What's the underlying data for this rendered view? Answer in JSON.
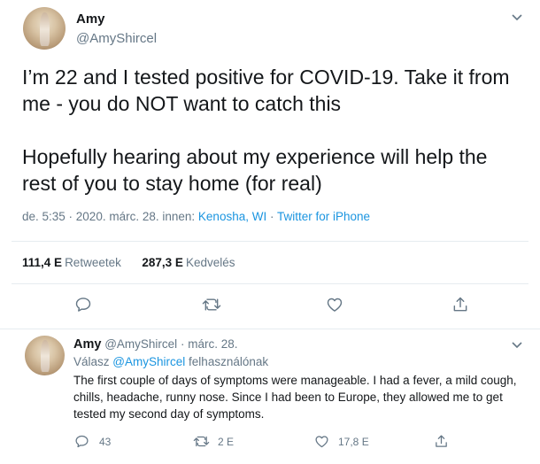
{
  "tweet": {
    "author_name": "Amy",
    "author_handle": "@AmyShircel",
    "menu_icon": "chevron-down-icon",
    "text_para1": "I’m 22 and I tested positive for COVID-19. Take it from me - you do NOT want to catch this",
    "text_para2": "Hopefully hearing about my experience will help the rest of you to stay home (for real)",
    "timestamp": "de. 5:35 · 2020. márc. 28.",
    "location_prefix": "innen:",
    "location": "Kenosha, WI",
    "separator": "·",
    "source": "Twitter for iPhone",
    "retweets_count": "111,4 E",
    "retweets_label": "Retweetek",
    "likes_count": "287,3 E",
    "likes_label": "Kedvelés",
    "actions": [
      "reply-icon",
      "retweet-icon",
      "like-icon",
      "share-icon"
    ]
  },
  "reply": {
    "author_name": "Amy",
    "author_handle": "@AmyShircel",
    "date": "· márc. 28.",
    "replying_prefix": "Válasz",
    "replying_to": "@AmyShircel",
    "replying_suffix": "felhasználónak",
    "text": "The first couple of days of symptoms were manageable. I had a fever, a mild cough, chills, headache, runny nose. Since I had been to Europe, they allowed me to get tested my second day of symptoms.",
    "reply_count": "43",
    "retweet_count": "2 E",
    "like_count": "17,8 E"
  },
  "colors": {
    "link": "#1b95e0",
    "secondary_text": "#657786",
    "primary_text": "#14171a",
    "divider": "#e6ecf0"
  }
}
